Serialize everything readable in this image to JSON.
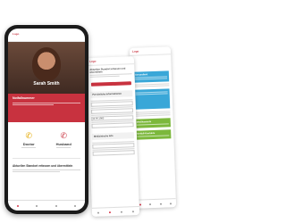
{
  "front": {
    "app_logo": "Logo",
    "profile_name": "Sarah Smith",
    "emergency_title": "Notfallnummer",
    "contact_1": "Doctor",
    "contact_2": "Husband",
    "bottom_section_title": "Aktuellen Standort erfassen und übermitteln"
  },
  "middle": {
    "title": "Aktuellen Standort erfassen und übermitteln",
    "section_1": "Persönliche Informationen",
    "section_2": "Medizinische Info",
    "field_value_1": "12.06.1985"
  },
  "back": {
    "section_1": "Gesundheit",
    "section_2": "Medikamente",
    "section_3": "Notfall-Kontakte"
  },
  "colors": {
    "accent": "#c8323f",
    "blue": "#39a7d8",
    "green": "#7cb83c"
  }
}
